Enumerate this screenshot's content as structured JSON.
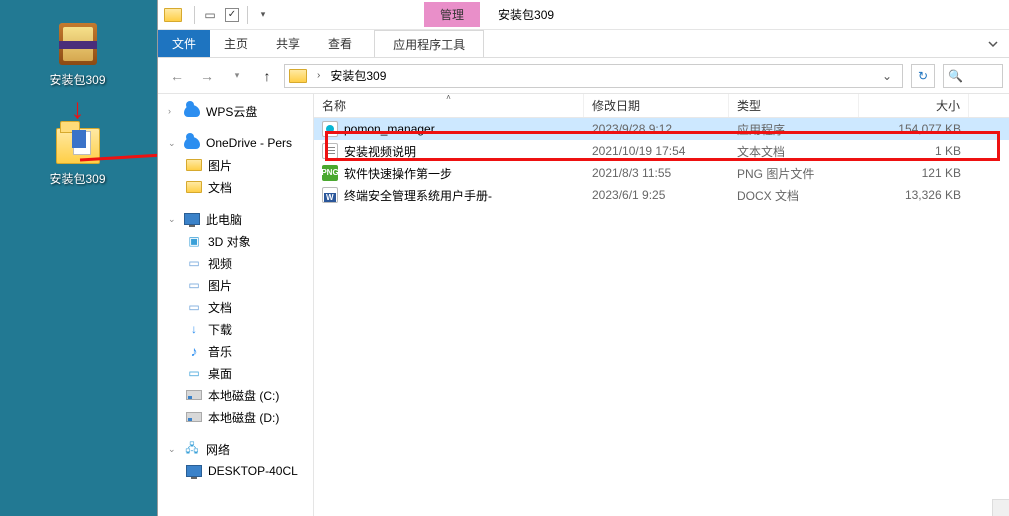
{
  "desktop": {
    "icon1_label": "安装包309",
    "icon2_label": "安装包309"
  },
  "window": {
    "title": "安装包309",
    "ribbon_context": "管理",
    "menu": {
      "file": "文件",
      "home": "主页",
      "share": "共享",
      "view": "查看",
      "context_tool": "应用程序工具"
    },
    "breadcrumb": {
      "folder": "安装包309"
    },
    "search_placeholder": "搜"
  },
  "tree": {
    "wps": "WPS云盘",
    "onedrive": "OneDrive - Pers",
    "pictures": "图片",
    "documents": "文档",
    "this_pc": "此电脑",
    "objects3d": "3D 对象",
    "videos": "视频",
    "pictures2": "图片",
    "documents2": "文档",
    "downloads": "下载",
    "music": "音乐",
    "desktop": "桌面",
    "disk_c": "本地磁盘 (C:)",
    "disk_d": "本地磁盘 (D:)",
    "network": "网络",
    "desktop_pc": "DESKTOP-40CL"
  },
  "columns": {
    "name": "名称",
    "date": "修改日期",
    "type": "类型",
    "size": "大小"
  },
  "files": [
    {
      "name": "pomon_manager",
      "date": "2023/9/28 9:12",
      "type": "应用程序",
      "size": "154,077 KB",
      "icon": "exe",
      "selected": true
    },
    {
      "name": "安装视频说明",
      "date": "2021/10/19 17:54",
      "type": "文本文档",
      "size": "1 KB",
      "icon": "txt",
      "selected": false
    },
    {
      "name": "软件快速操作第一步",
      "date": "2021/8/3 11:55",
      "type": "PNG 图片文件",
      "size": "121 KB",
      "icon": "png",
      "selected": false
    },
    {
      "name": "终端安全管理系统用户手册-",
      "date": "2023/6/1 9:25",
      "type": "DOCX 文档",
      "size": "13,326 KB",
      "icon": "docx",
      "selected": false
    }
  ]
}
